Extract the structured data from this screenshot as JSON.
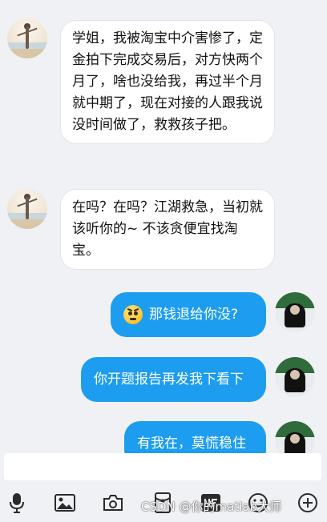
{
  "messages": [
    {
      "side": "incoming",
      "text": "学姐，我被淘宝中介害惨了，定金拍下完成交易后，对方快两个月了，啥也没给我，再过半个月就中期了，现在对接的人跟我说没时间做了，救救孩子把。",
      "avatar_icon": "beach-girl-avatar"
    },
    {
      "side": "incoming",
      "text": "在吗？在吗？江湖救急，当初就该听你的~ 不该贪便宜找淘宝。",
      "avatar_icon": "beach-girl-avatar"
    },
    {
      "side": "outgoing",
      "emoji": "frown-emoji",
      "text": "那钱退给你没?",
      "avatar_icon": "hooded-person-avatar"
    },
    {
      "side": "outgoing",
      "text": "你开题报告再发我下看下",
      "avatar_icon": "hooded-person-avatar"
    },
    {
      "side": "outgoing",
      "text": "有我在，莫慌稳住",
      "avatar_icon": "hooded-person-avatar",
      "partially_visible": true
    }
  ],
  "input": {
    "value": ""
  },
  "toolbar": [
    {
      "icon": "microphone-icon"
    },
    {
      "icon": "image-icon"
    },
    {
      "icon": "camera-icon"
    },
    {
      "icon": "red-packet-icon"
    },
    {
      "icon": "gif-icon"
    },
    {
      "icon": "emoji-icon"
    },
    {
      "icon": "add-icon"
    }
  ],
  "watermark": "CSDN @你的matlab大师",
  "colors": {
    "background": "#f0f1f5",
    "incoming_bubble": "#ffffff",
    "outgoing_bubble": "#1d9df0",
    "icon": "#2b2b2b"
  }
}
